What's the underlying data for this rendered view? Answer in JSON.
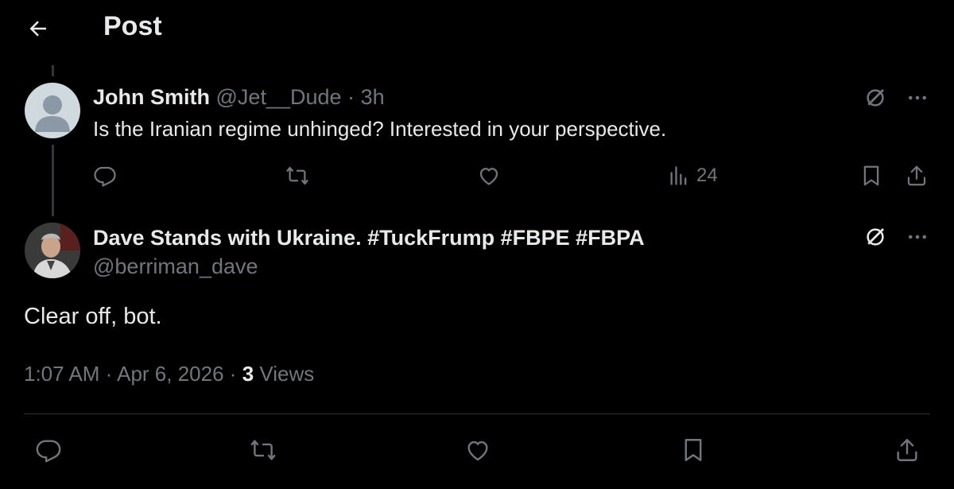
{
  "header": {
    "title": "Post"
  },
  "parent_post": {
    "author_name": "John Smith",
    "handle": "@Jet__Dude",
    "separator": "·",
    "time": "3h",
    "text": "Is the Iranian regime unhinged? Interested in your perspective.",
    "views": "24"
  },
  "focal_post": {
    "author_name": "Dave Stands with Ukraine. #TuckFrump #FBPE #FBPA",
    "handle": "@berriman_dave",
    "text": "Clear off, bot.",
    "time": "1:07 AM",
    "date": "Apr 6, 2026",
    "separator": "·",
    "views_count": "3",
    "views_label": "Views"
  },
  "icons": {
    "back": "arrow-left-icon",
    "grok": "grok-icon",
    "more": "more-icon",
    "reply": "reply-icon",
    "repost": "repost-icon",
    "like": "like-icon",
    "views": "views-icon",
    "bookmark": "bookmark-icon",
    "share": "share-icon"
  },
  "colors": {
    "background": "#000000",
    "text": "#e7e9ea",
    "muted": "#71767b",
    "divider": "#2f3336"
  }
}
